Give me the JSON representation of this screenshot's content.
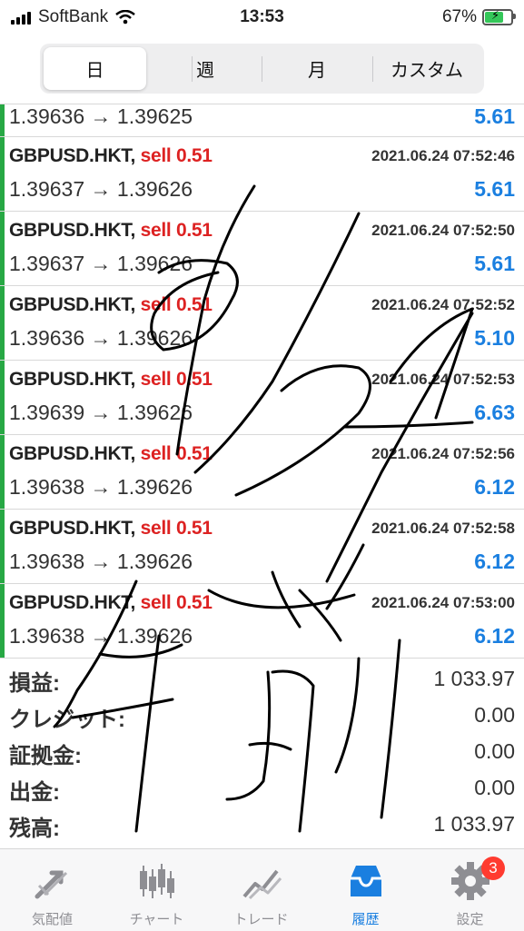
{
  "status_bar": {
    "carrier": "SoftBank",
    "time": "13:53",
    "battery": "67%"
  },
  "period_tabs": [
    {
      "label": "日",
      "active": true
    },
    {
      "label": "週",
      "active": false
    },
    {
      "label": "月",
      "active": false
    },
    {
      "label": "カスタム",
      "active": false
    }
  ],
  "partial_row": {
    "prices": "1.39636 → 1.39625",
    "profit": "5.61"
  },
  "trades": [
    {
      "symbol": "GBPUSD.HKT,",
      "side": "sell 0.51",
      "datetime": "2021.06.24 07:52:46",
      "prices": "1.39637 → 1.39626",
      "profit": "5.61"
    },
    {
      "symbol": "GBPUSD.HKT,",
      "side": "sell 0.51",
      "datetime": "2021.06.24 07:52:50",
      "prices": "1.39637 → 1.39626",
      "profit": "5.61"
    },
    {
      "symbol": "GBPUSD.HKT,",
      "side": "sell 0.51",
      "datetime": "2021.06.24 07:52:52",
      "prices": "1.39636 → 1.39626",
      "profit": "5.10"
    },
    {
      "symbol": "GBPUSD.HKT,",
      "side": "sell 0.51",
      "datetime": "2021.06.24 07:52:53",
      "prices": "1.39639 → 1.39626",
      "profit": "6.63"
    },
    {
      "symbol": "GBPUSD.HKT,",
      "side": "sell 0.51",
      "datetime": "2021.06.24 07:52:56",
      "prices": "1.39638 → 1.39626",
      "profit": "6.12"
    },
    {
      "symbol": "GBPUSD.HKT,",
      "side": "sell 0.51",
      "datetime": "2021.06.24 07:52:58",
      "prices": "1.39638 → 1.39626",
      "profit": "6.12"
    },
    {
      "symbol": "GBPUSD.HKT,",
      "side": "sell 0.51",
      "datetime": "2021.06.24 07:53:00",
      "prices": "1.39638 → 1.39626",
      "profit": "6.12"
    }
  ],
  "summary": [
    {
      "label": "損益:",
      "value": "1 033.97"
    },
    {
      "label": "クレジット:",
      "value": "0.00"
    },
    {
      "label": "証拠金:",
      "value": "0.00"
    },
    {
      "label": "出金:",
      "value": "0.00"
    },
    {
      "label": "残高:",
      "value": "1 033.97"
    }
  ],
  "bottom_nav": [
    {
      "label": "気配値",
      "icon": "quotes-icon"
    },
    {
      "label": "チャート",
      "icon": "chart-icon"
    },
    {
      "label": "トレード",
      "icon": "trade-icon"
    },
    {
      "label": "履歴",
      "icon": "history-icon",
      "active": true
    },
    {
      "label": "設定",
      "icon": "settings-icon",
      "badge": "3"
    }
  ],
  "colors": {
    "accent": "#1a7fe0",
    "sell": "#dd2222",
    "row_bar": "#27a844",
    "badge": "#ff3b30"
  }
}
